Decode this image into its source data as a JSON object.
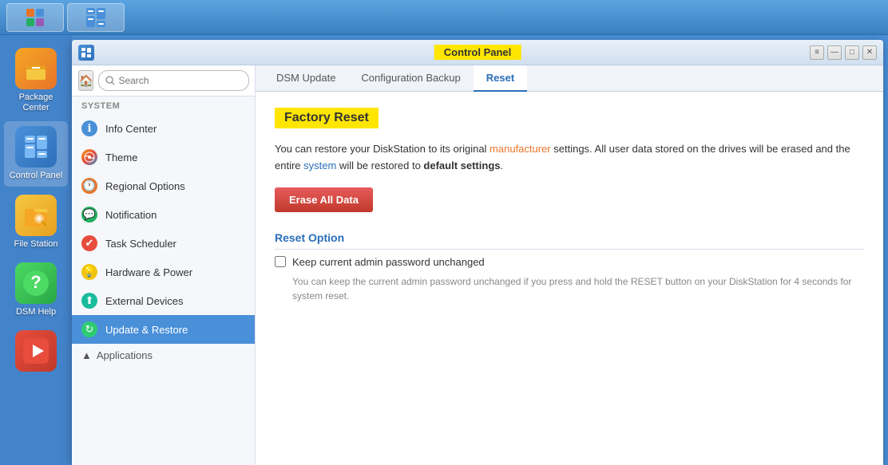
{
  "taskbar": {
    "apps": [
      {
        "id": "grid",
        "label": "",
        "icon": "⊞",
        "class": "icon-package",
        "active": true
      },
      {
        "id": "control-panel-taskbar",
        "label": "",
        "icon": "☰",
        "class": "icon-control",
        "active": true
      }
    ]
  },
  "sidebar_apps": [
    {
      "id": "package-center",
      "label": "Package Center",
      "emoji": "🎁",
      "class": "icon-package",
      "active": false
    },
    {
      "id": "control-panel",
      "label": "Control Panel",
      "emoji": "⚙",
      "class": "icon-control",
      "active": true
    },
    {
      "id": "file-station",
      "label": "File Station",
      "emoji": "📁",
      "class": "icon-filestation",
      "active": false
    },
    {
      "id": "dsm-help",
      "label": "DSM Help",
      "emoji": "?",
      "class": "icon-dsmhelp",
      "active": false
    },
    {
      "id": "video",
      "label": "",
      "emoji": "▶",
      "class": "icon-video",
      "active": false
    }
  ],
  "window": {
    "title": "Control Panel",
    "icon": "☰"
  },
  "nav": {
    "search_placeholder": "Search",
    "section_system": "System",
    "items": [
      {
        "id": "info-center",
        "label": "Info Center",
        "icon": "ℹ",
        "icon_class": "blue"
      },
      {
        "id": "theme",
        "label": "Theme",
        "icon": "◉",
        "icon_class": "multi"
      },
      {
        "id": "regional-options",
        "label": "Regional Options",
        "icon": "🕐",
        "icon_class": "orange"
      },
      {
        "id": "notification",
        "label": "Notification",
        "icon": "💬",
        "icon_class": "green"
      },
      {
        "id": "task-scheduler",
        "label": "Task Scheduler",
        "icon": "✔",
        "icon_class": "red-check"
      },
      {
        "id": "hardware-power",
        "label": "Hardware & Power",
        "icon": "💡",
        "icon_class": "yellow"
      },
      {
        "id": "external-devices",
        "label": "External Devices",
        "icon": "⬆",
        "icon_class": "teal"
      },
      {
        "id": "update-restore",
        "label": "Update & Restore",
        "icon": "↻",
        "icon_class": "green-arrow",
        "active": true
      }
    ],
    "applications_label": "Applications"
  },
  "tabs": [
    {
      "id": "dsm-update",
      "label": "DSM Update",
      "active": false
    },
    {
      "id": "config-backup",
      "label": "Configuration Backup",
      "active": false
    },
    {
      "id": "reset",
      "label": "Reset",
      "active": true
    }
  ],
  "content": {
    "factory_reset_title": "Factory Reset",
    "description_line1": "You can restore your DiskStation to its original",
    "description_highlight1": "manufacturer",
    "description_line2": "settings. All user data stored on the drives will be erased and the entire",
    "description_highlight2": "system",
    "description_line3": "will be restored to",
    "description_highlight3": "default settings",
    "description_end": ".",
    "erase_button_label": "Erase All Data",
    "reset_option_title": "Reset Option",
    "checkbox_label": "Keep current admin password unchanged",
    "hint_text": "You can keep the current admin password unchanged if you press and hold the RESET button on your DiskStation for 4 seconds for system reset."
  },
  "window_controls": {
    "minimize": "—",
    "restore": "□",
    "close": "✕",
    "menu": "≡"
  }
}
